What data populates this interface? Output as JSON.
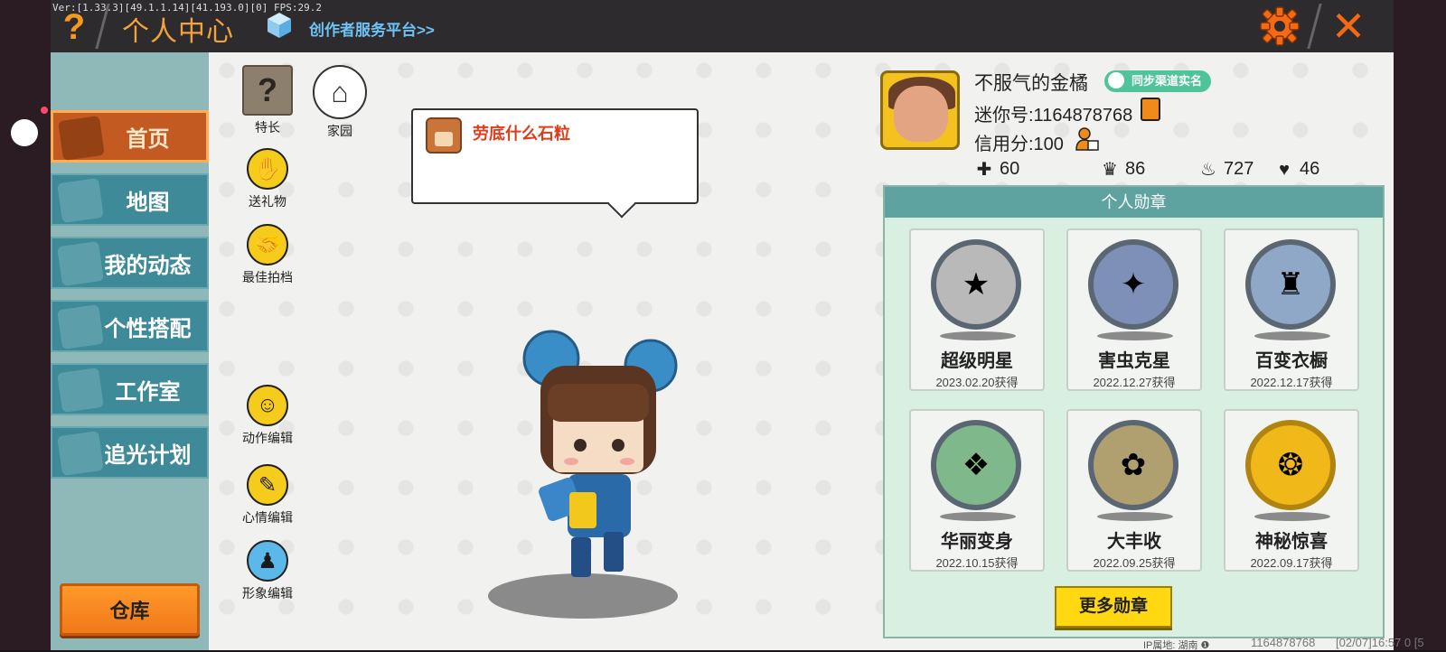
{
  "debug": {
    "fps_text": "Ver:[1.33.3][49.1.1.14][41.193.0][0] FPS:29.2"
  },
  "header": {
    "help_icon": "?",
    "title": "个人中心",
    "creator_link": "创作者服务平台>>",
    "close_icon": "✕"
  },
  "sidebar": {
    "items": [
      {
        "label": "首页",
        "icon": "house-icon",
        "active": true
      },
      {
        "label": "地图",
        "icon": "map-icon",
        "active": false
      },
      {
        "label": "我的动态",
        "icon": "bell-icon",
        "active": false
      },
      {
        "label": "个性搭配",
        "icon": "outfit-icon",
        "active": false
      },
      {
        "label": "工作室",
        "icon": "studio-icon",
        "active": false
      },
      {
        "label": "追光计划",
        "icon": "light-icon",
        "active": false
      }
    ],
    "warehouse_label": "仓库"
  },
  "quick_actions": {
    "specialty": "特长",
    "homeland": "家园",
    "send_gift": "送礼物",
    "best_photo": "最佳拍档",
    "action_edit": "动作编辑",
    "mood_edit": "心情编辑",
    "image_edit": "形象编辑"
  },
  "mood_bubble": {
    "text": "劳底什么石粒"
  },
  "profile": {
    "nickname": "不服气的金橘",
    "verify_badge": "同步渠道实名",
    "mini_id": "迷你号:1164878768",
    "credit": "信用分:100",
    "stats": [
      {
        "icon": "add-friend-icon",
        "value": "60"
      },
      {
        "icon": "fans-icon",
        "value": "86"
      },
      {
        "icon": "fire-icon",
        "value": "727"
      },
      {
        "icon": "heart-icon",
        "value": "46"
      }
    ]
  },
  "medals": {
    "title": "个人勋章",
    "items": [
      {
        "name": "超级明星",
        "date": "2023.02.20获得",
        "color": "#b9b9b9"
      },
      {
        "name": "害虫克星",
        "date": "2022.12.27获得",
        "color": "#7e8fb8"
      },
      {
        "name": "百变衣橱",
        "date": "2022.12.17获得",
        "color": "#8fa8c8"
      },
      {
        "name": "华丽变身",
        "date": "2022.10.15获得",
        "color": "#7fb88a"
      },
      {
        "name": "大丰收",
        "date": "2022.09.25获得",
        "color": "#b0a070"
      },
      {
        "name": "神秘惊喜",
        "date": "2022.09.17获得",
        "color": "#f0b818"
      }
    ],
    "more_label": "更多勋章"
  },
  "footer": {
    "ip_location": "IP属地: 湖南 ❶",
    "user_id": "1164878768",
    "time": "[02/07]16:57 0 [5"
  },
  "colors": {
    "accent_orange": "#f39a1f",
    "nav_active": "#c25a22",
    "nav_normal": "#3f8a98",
    "medal_panel": "#d8efe2",
    "medal_header": "#5fa3a1"
  }
}
